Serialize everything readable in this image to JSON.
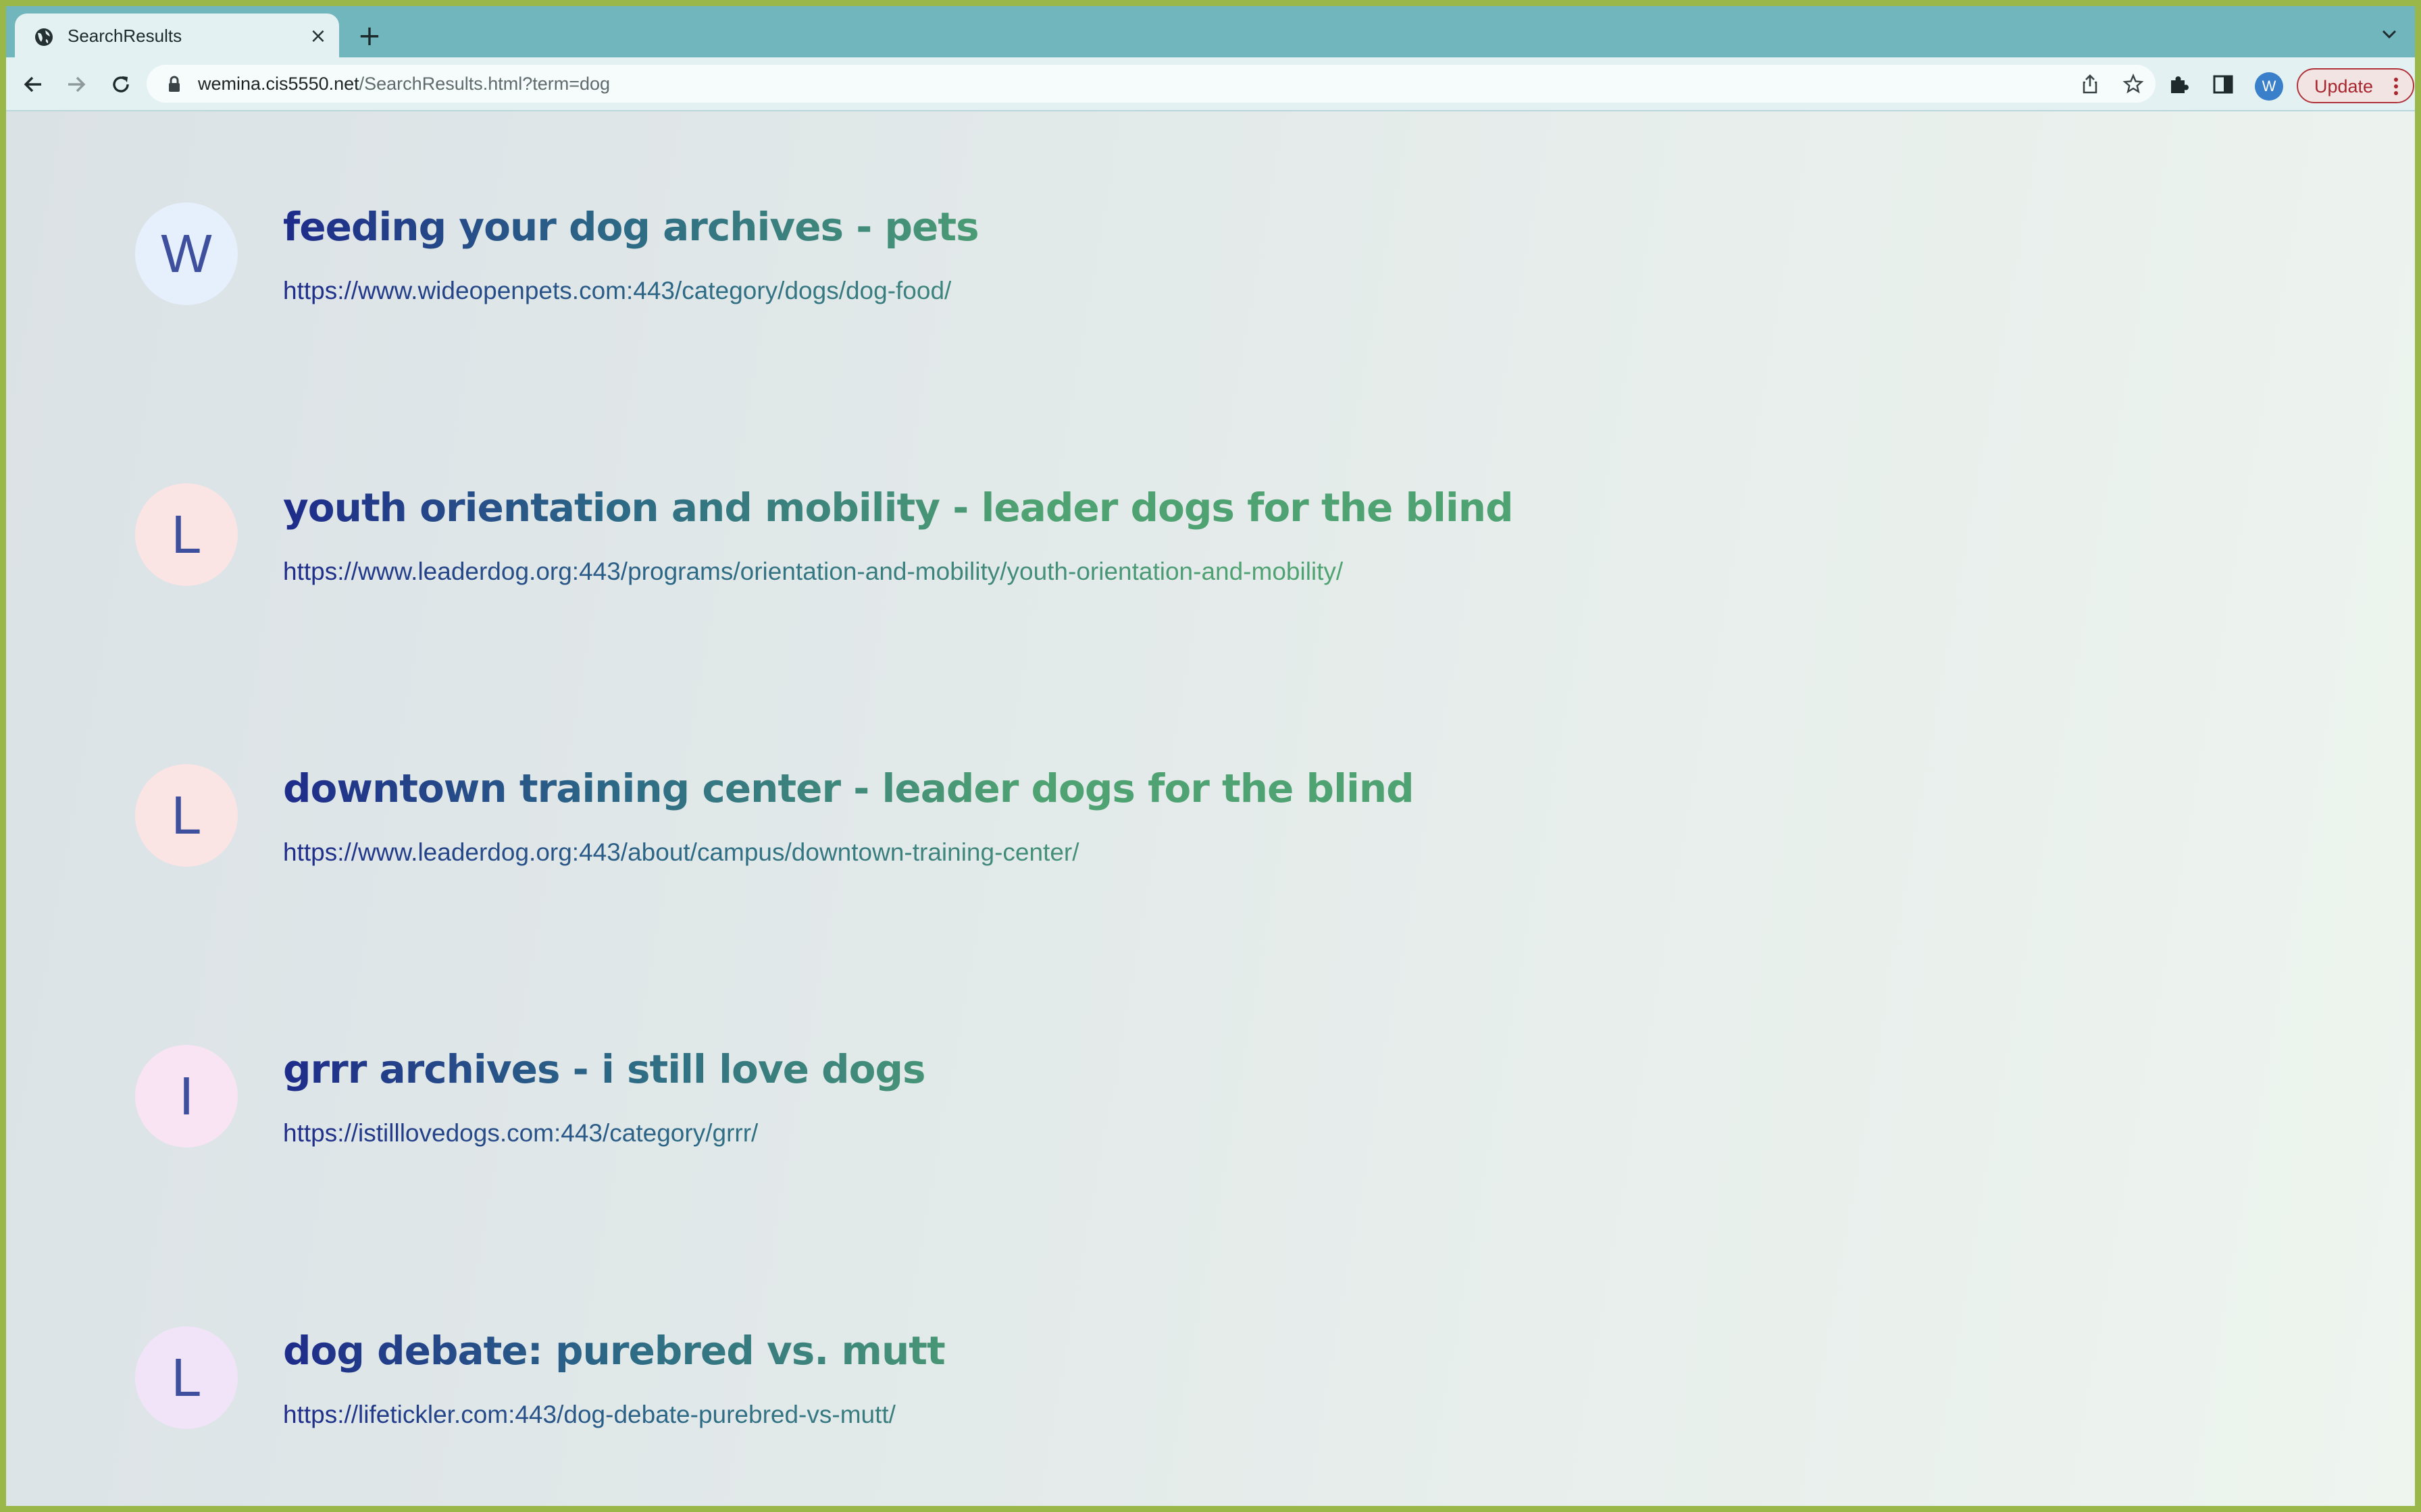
{
  "browser": {
    "tab": {
      "title": "SearchResults",
      "close_glyph": "×"
    },
    "new_tab_glyph": "+",
    "address": {
      "host": "wemina.cis5550.net",
      "path": "/SearchResults.html?term=dog"
    },
    "profile_initial": "W",
    "update_label": "Update"
  },
  "results": [
    {
      "letter": "W",
      "title": "feeding your dog archives - pets",
      "url": "https://www.wideopenpets.com:443/category/dogs/dog-food/",
      "circle_color": "#e6effc"
    },
    {
      "letter": "L",
      "title": "youth orientation and mobility - leader dogs for the blind",
      "url": "https://www.leaderdog.org:443/programs/orientation-and-mobility/youth-orientation-and-mobility/",
      "circle_color": "#fbe4e4"
    },
    {
      "letter": "L",
      "title": "downtown training center - leader dogs for the blind",
      "url": "https://www.leaderdog.org:443/about/campus/downtown-training-center/",
      "circle_color": "#fbe4e4"
    },
    {
      "letter": "I",
      "title": "grrr archives - i still love dogs",
      "url": "https://istilllovedogs.com:443/category/grrr/",
      "circle_color": "#f9e4f4"
    },
    {
      "letter": "L",
      "title": "dog debate: purebred vs. mutt",
      "url": "https://lifetickler.com:443/dog-debate-purebred-vs-mutt/",
      "circle_color": "#f1e4f8"
    }
  ]
}
